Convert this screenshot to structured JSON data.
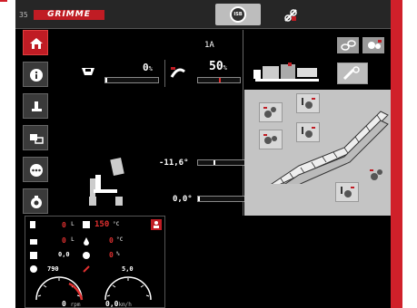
{
  "page_number": "35",
  "brand": "GRIMME",
  "isobus_label": "ISB",
  "colors": {
    "accent": "#c01c24",
    "warning": "#e03030"
  },
  "sidebar": [
    {
      "name": "home",
      "icon": "home-icon",
      "active": true
    },
    {
      "name": "info",
      "icon": "info-icon"
    },
    {
      "name": "operator",
      "icon": "operator-icon"
    },
    {
      "name": "transfer",
      "icon": "transfer-icon"
    },
    {
      "name": "more",
      "icon": "more-icon"
    },
    {
      "name": "settings",
      "icon": "gear-icon"
    }
  ],
  "main": {
    "mode_label": "1A",
    "hopper_level": "0",
    "hopper_level_unit": "%",
    "hopper_fill": 0,
    "chain_speed": "50",
    "chain_speed_unit": "%",
    "chain_fill": 0.5,
    "tilt_angle": "-11,6",
    "tilt_unit": "°",
    "tilt_indicator": 0.3,
    "steer_angle": "0,0",
    "steer_unit": "°",
    "steer_indicator": 0.0
  },
  "stats": {
    "fuel_value": "0",
    "fuel_unit": "L",
    "temp_value": "150",
    "temp_unit": "°C",
    "hyd_value": "0",
    "hyd_unit": "L",
    "oil_temp_value": "0",
    "oil_temp_unit": "°C",
    "pressure_value": "0,0",
    "pressure_unit": "",
    "load_value": "0",
    "load_unit": "%",
    "rpm_left": "790",
    "speed_right": "5,0",
    "rpm_value": "0",
    "rpm_unit": "rpm",
    "speed_value": "0,0",
    "speed_unit": "km/h"
  },
  "right_panel": {
    "top_buttons": [
      "chain-link-icon",
      "chain-gear-icon"
    ],
    "tools": [
      "sensor-icon-1",
      "sensor-icon-2",
      "sensor-icon-3",
      "sensor-icon-4"
    ]
  }
}
